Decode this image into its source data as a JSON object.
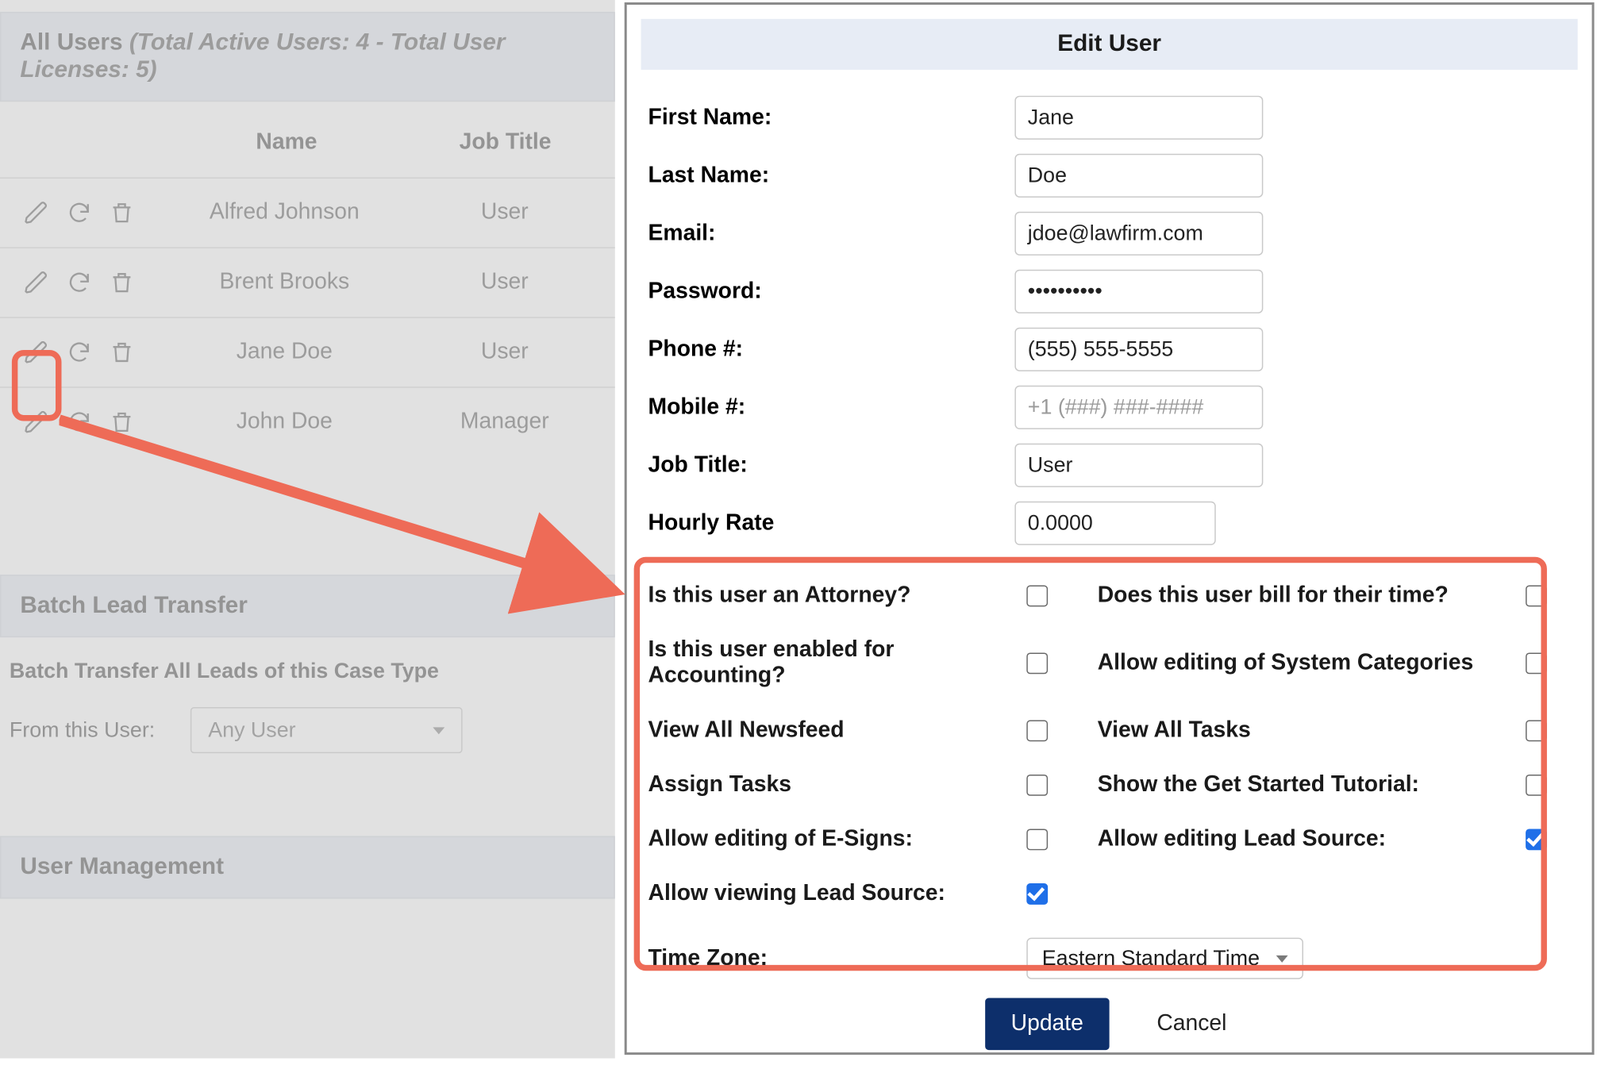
{
  "left": {
    "all_users_header": "All Users",
    "all_users_subtext": "(Total Active Users: 4 - Total User Licenses: 5)",
    "columns": {
      "name": "Name",
      "job_title": "Job Title"
    },
    "rows": [
      {
        "name": "Alfred Johnson",
        "title": "User"
      },
      {
        "name": "Brent Brooks",
        "title": "User"
      },
      {
        "name": "Jane Doe",
        "title": "User"
      },
      {
        "name": "John Doe",
        "title": "Manager"
      }
    ],
    "batch_header": "Batch Lead Transfer",
    "batch_label": "Batch Transfer All Leads of this Case Type",
    "from_user_label": "From this User:",
    "from_user_value": "Any User",
    "user_mgmt_header": "User Management"
  },
  "modal": {
    "title": "Edit User",
    "fields": {
      "first_name_label": "First Name:",
      "first_name_value": "Jane",
      "last_name_label": "Last Name:",
      "last_name_value": "Doe",
      "email_label": "Email:",
      "email_value": "jdoe@lawfirm.com",
      "password_label": "Password:",
      "password_value": "••••••••••",
      "phone_label": "Phone #:",
      "phone_value": "(555) 555-5555",
      "mobile_label": "Mobile #:",
      "mobile_placeholder": "+1 (###) ###-####",
      "job_title_label": "Job Title:",
      "job_title_value": "User",
      "hourly_rate_label": "Hourly Rate",
      "hourly_rate_value": "0.0000"
    },
    "checks": {
      "attorney": "Is this user an Attorney?",
      "bill_time": "Does this user bill for their time?",
      "accounting": "Is this user enabled for Accounting?",
      "sys_cat": "Allow editing of System Categories",
      "view_newsfeed": "View All Newsfeed",
      "view_tasks": "View All Tasks",
      "assign_tasks": "Assign Tasks",
      "tutorial": "Show the Get Started Tutorial:",
      "edit_esigns": "Allow editing of E-Signs:",
      "edit_lead_source": "Allow editing Lead Source:",
      "view_lead_source": "Allow viewing Lead Source:"
    },
    "checked": {
      "attorney": false,
      "bill_time": false,
      "accounting": false,
      "sys_cat": false,
      "view_newsfeed": false,
      "view_tasks": false,
      "assign_tasks": false,
      "tutorial": false,
      "edit_esigns": false,
      "edit_lead_source": true,
      "view_lead_source": true
    },
    "timezone_label": "Time Zone:",
    "timezone_value": "Eastern Standard Time",
    "update_button": "Update",
    "cancel_button": "Cancel"
  }
}
